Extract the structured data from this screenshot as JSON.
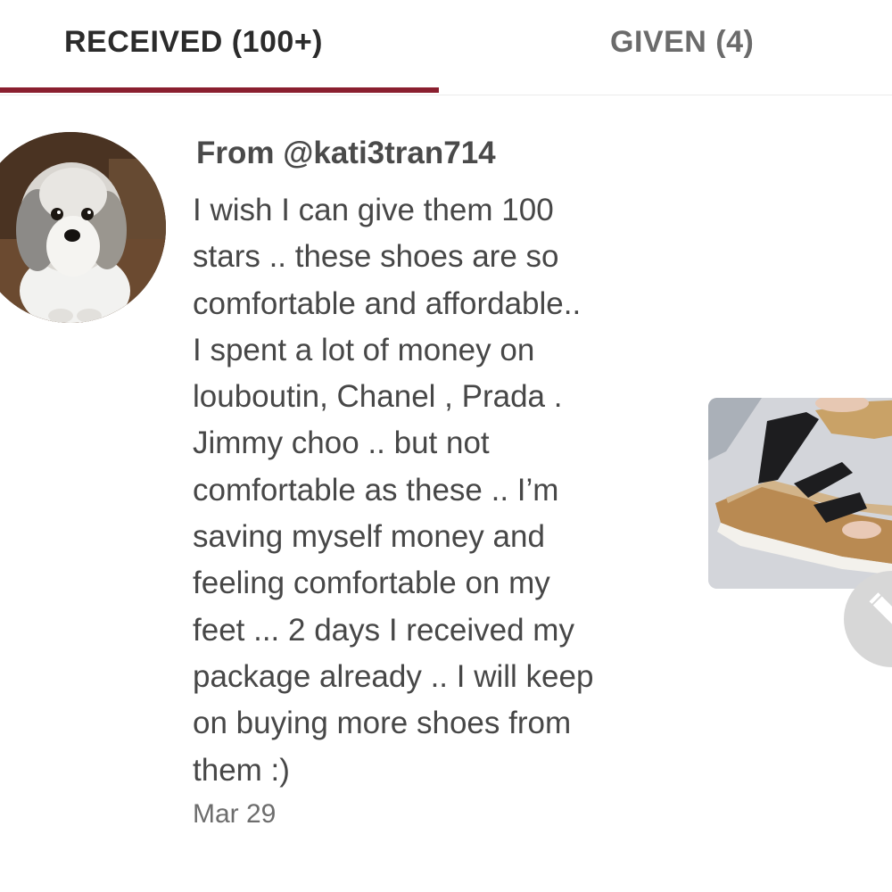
{
  "tabs": [
    {
      "label": "RECEIVED (100+)",
      "active": true
    },
    {
      "label": "GIVEN (4)",
      "active": false
    }
  ],
  "colors": {
    "active_indicator": "#8a1f2f",
    "active_tab_text": "#2b2b2b",
    "inactive_tab_text": "#6b6b6b",
    "message_text": "#474747"
  },
  "review": {
    "from": "From @kati3tran714",
    "message": "I wish I can give them 100\nstars .. these shoes are so\ncomfortable and affordable..\nI spent a lot of money on\nlouboutin, Chanel , Prada .\nJimmy choo .. but not\ncomfortable as these .. I’m\nsaving myself money and\nfeeling comfortable on my\nfeet ... 2 days I received my\npackage already .. I will keep\non buying more shoes from\nthem :)",
    "date": "Mar 29",
    "avatar_icon": "dog-avatar-icon",
    "thumbnail_icon": "sandal-photo-icon"
  },
  "fab": {
    "icon": "pencil-icon"
  }
}
